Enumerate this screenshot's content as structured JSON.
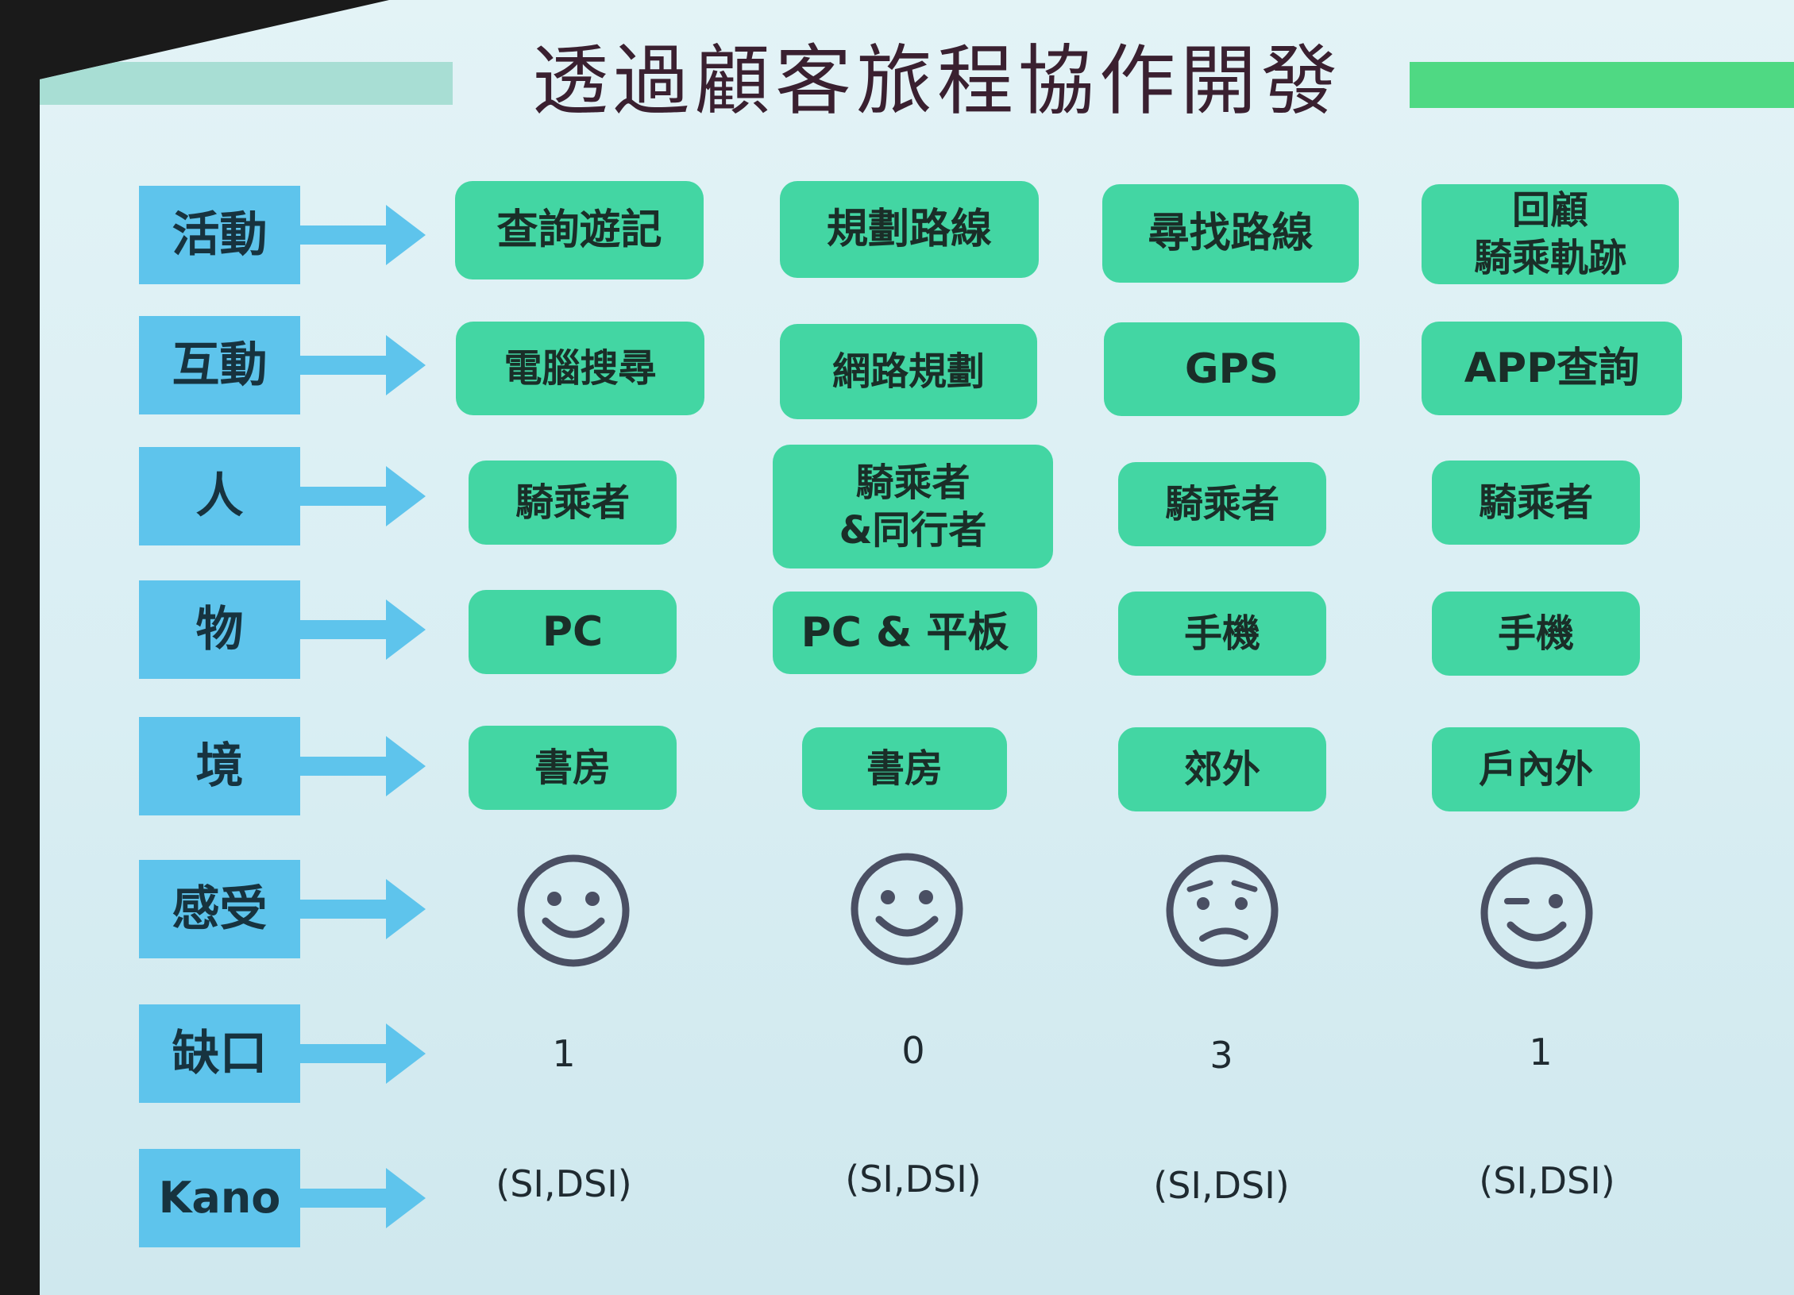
{
  "title": "透過顧客旅程協作開發",
  "row_labels": [
    "活動",
    "互動",
    "人",
    "物",
    "境",
    "感受",
    "缺口",
    "Kano"
  ],
  "activity": [
    "查詢遊記",
    "規劃路線",
    "尋找路線",
    "回顧\n騎乘軌跡"
  ],
  "interaction": [
    "電腦搜尋",
    "網路規劃",
    "GPS",
    "APP查詢"
  ],
  "people": [
    "騎乘者",
    "騎乘者\n&同行者",
    "騎乘者",
    "騎乘者"
  ],
  "objects": [
    "PC",
    "PC & 平板",
    "手機",
    "手機"
  ],
  "environment": [
    "書房",
    "書房",
    "郊外",
    "戶內外"
  ],
  "feelings": [
    "smile-face-icon",
    "smile-face-icon",
    "worried-face-icon",
    "wink-face-icon"
  ],
  "gaps": [
    "1",
    "0",
    "3",
    "1"
  ],
  "kano": [
    "(SI,DSI)",
    "(SI,DSI)",
    "(SI,DSI)",
    "(SI,DSI)"
  ],
  "colors": {
    "label_bg": "#5ec4ec",
    "box_bg": "#43d6a3",
    "arrow": "#5ec4ec",
    "face": "#4a4f63"
  }
}
